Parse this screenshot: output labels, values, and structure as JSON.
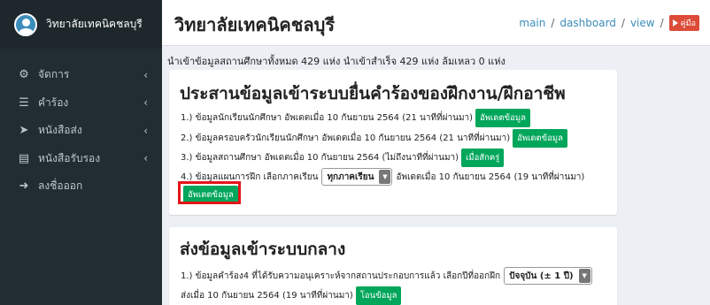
{
  "app": {
    "brand": "วิทยาลัยเทคนิคชลบุรี"
  },
  "sidebar": {
    "items": [
      {
        "label": "จัดการ",
        "icon": "cogs-icon",
        "has_submenu": true
      },
      {
        "label": "คำร้อง",
        "icon": "list-icon",
        "has_submenu": true
      },
      {
        "label": "หนังสือส่ง",
        "icon": "send-icon",
        "has_submenu": true
      },
      {
        "label": "หนังสือรับรอง",
        "icon": "document-icon",
        "has_submenu": true
      },
      {
        "label": "ลงชื่อออก",
        "icon": "sign-out-icon",
        "has_submenu": false
      }
    ],
    "chevron": "‹"
  },
  "header": {
    "title": "วิทยาลัยเทคนิคชลบุรี",
    "breadcrumb": [
      "main",
      "dashboard",
      "view"
    ],
    "separator": "/",
    "manual_label": "คู่มือ"
  },
  "summary": "นำเข้าข้อมูลสถานศึกษาทั้งหมด 429 แห่ง นำเข้าสำเร็จ 429 แห่ง ล้มเหลว 0 แห่ง",
  "box1": {
    "title": "ประสานข้อมูลเข้าระบบยื่นคำร้องของฝึกงาน/ฝึกอาชีพ",
    "line1": {
      "text": "1.) ข้อมูลนักเรียนนักศึกษา อัพเดตเมื่อ 10 กันยายน 2564 (21 นาทีที่ผ่านมา)",
      "button": "อัพเดตข้อมูล"
    },
    "line2": {
      "text": "2.) ข้อมูลครอบครัวนักเรียนนักศึกษา อัพเดตเมื่อ 10 กันยายน 2564 (21 นาทีที่ผ่านมา)",
      "button": "อัพเดตข้อมูล"
    },
    "line3": {
      "text": "3.) ข้อมูลสถานศึกษา อัพเดตเมื่อ 10 กันยายน 2564 (ไม่ถึงนาทีที่ผ่านมา)",
      "button": "เมื่อสักครู่"
    },
    "line4": {
      "text_before": "4.) ข้อมูลแผนการฝึก เลือกภาคเรียน",
      "select_value": "ทุกภาคเรียน",
      "text_after": "อัพเดตเมื่อ 10 กันยายน 2564 (19 นาทีที่ผ่านมา)",
      "button": "อัพเดตข้อมูล"
    },
    "highlight_color": "#e3151a"
  },
  "box2": {
    "title": "ส่งข้อมูลเข้าระบบกลาง",
    "line1": {
      "text": "1.) ข้อมูลคำร้อง4 ที่ได้รับความอนุเคราะห์จากสถานประกอบการแล้ว เลือกปีที่ออกฝึก",
      "select_value": "ปัจจุบัน (± 1 ปี)"
    },
    "line2": {
      "text": "ส่งเมื่อ 10 กันยายน 2564 (19 นาทีที่ผ่านมา)",
      "button": "โอนข้อมูล"
    }
  },
  "colors": {
    "sidebar": "#222d32",
    "accent": "#3c8dbc",
    "success": "#00a65a",
    "danger": "#dd4b39"
  }
}
